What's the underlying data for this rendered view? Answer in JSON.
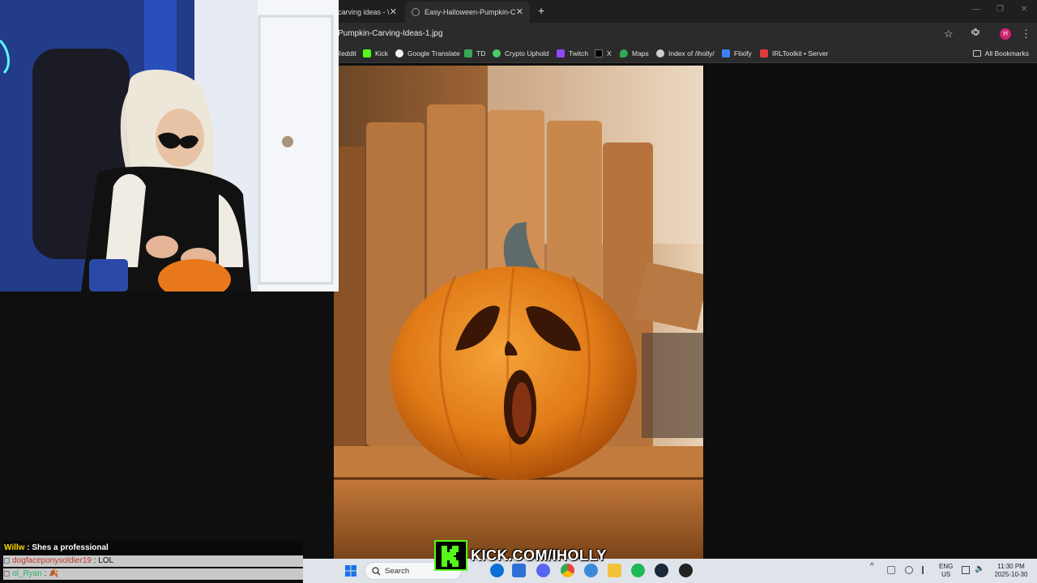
{
  "browser": {
    "tabs": [
      {
        "title": "carving ideas - \\",
        "active": false
      },
      {
        "title": "Easy-Halloween-Pumpkin-Carvi",
        "active": true
      }
    ],
    "new_tab_icon": "plus-icon",
    "close_icon": "close-icon",
    "url": "Pumpkin-Carving-Ideas-1.jpg",
    "avatar_letter": "H",
    "bookmarks": [
      {
        "label": "Reddit",
        "icon_color": "#ff4500"
      },
      {
        "label": "Kick",
        "icon_color": "#53fc18"
      },
      {
        "label": "Google Translate",
        "icon_color": "#f2f2f2"
      },
      {
        "label": "TD",
        "icon_color": "#3aa856"
      },
      {
        "label": "Crypto Uphold",
        "icon_color": "#49cc68"
      },
      {
        "label": "Twitch",
        "icon_color": "#9146ff"
      },
      {
        "label": "X",
        "icon_color": "#000000"
      },
      {
        "label": "Maps",
        "icon_color": "#34a853"
      },
      {
        "label": "Index of /iholly/",
        "icon_color": "#cfcfcf"
      },
      {
        "label": "Flixify",
        "icon_color": "#3b82f6"
      },
      {
        "label": "IRLToolkit • Server",
        "icon_color": "#e23a3a"
      }
    ],
    "all_bookmarks": "All Bookmarks"
  },
  "chat": {
    "messages": [
      {
        "user": "Willw",
        "text": "Shes a professional",
        "user_color": "#ffd900"
      },
      {
        "user": "dogfaceponysoldier19",
        "text": "LOL",
        "user_color": "#c0392b"
      },
      {
        "user": "ol_Ryan",
        "text": "🍂",
        "user_color": "#27ae60"
      }
    ],
    "separator": " : "
  },
  "overlay": {
    "kick_text": "KICK.COM/IHOLLY"
  },
  "taskbar": {
    "search_placeholder": "Search",
    "language_top": "ENG",
    "language_bottom": "US",
    "time": "11:30 PM",
    "date": "2025-10-30"
  },
  "colors": {
    "kick_green": "#53fc18",
    "taskbar_bg": "#dfe3ea",
    "browser_bg": "#2b2b2b"
  }
}
